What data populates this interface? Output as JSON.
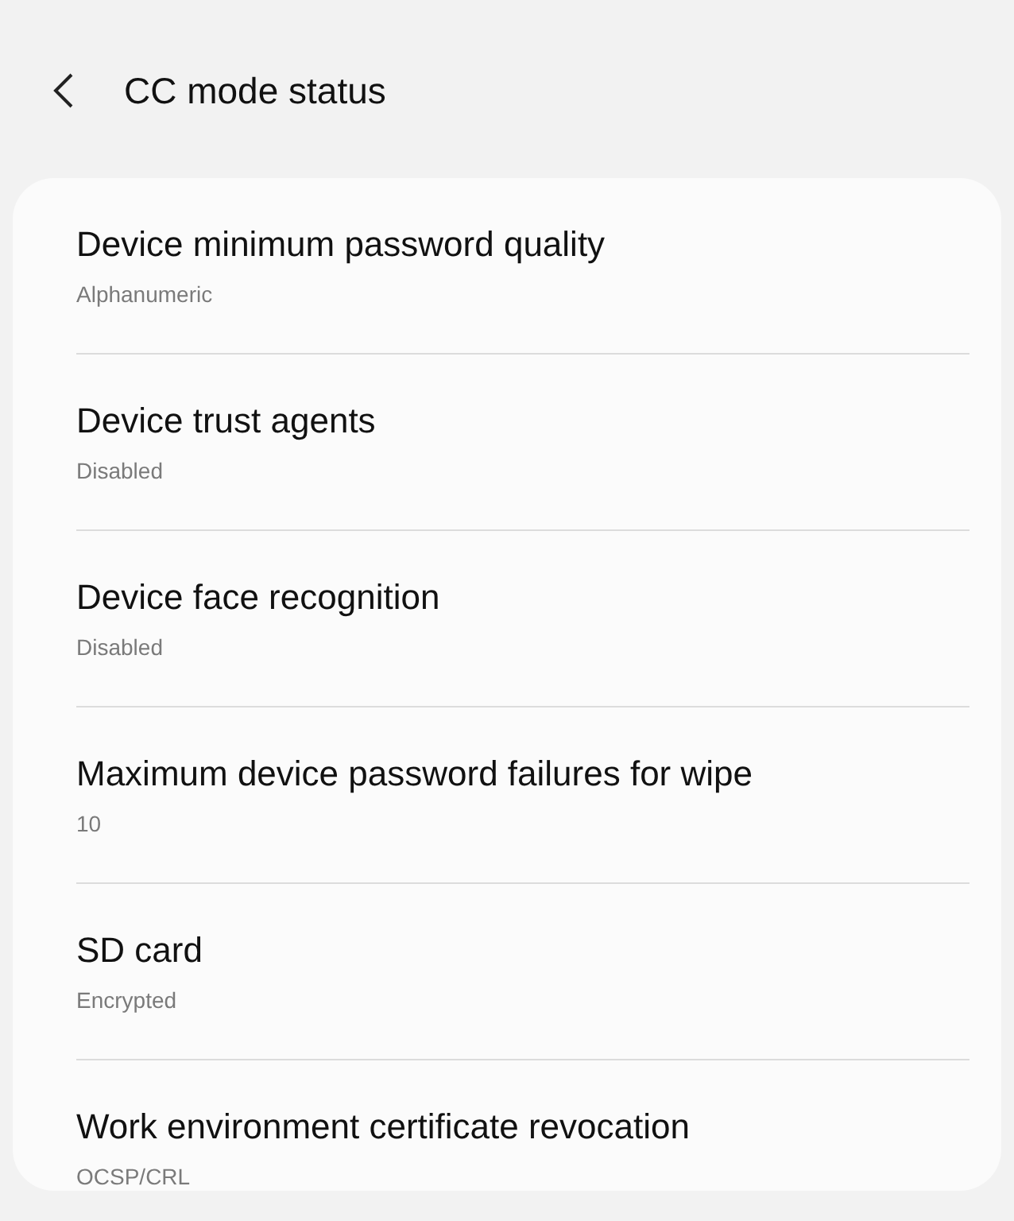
{
  "header": {
    "title": "CC mode status"
  },
  "items": [
    {
      "title": "Device minimum password quality",
      "value": "Alphanumeric"
    },
    {
      "title": "Device trust agents",
      "value": "Disabled"
    },
    {
      "title": "Device face recognition",
      "value": "Disabled"
    },
    {
      "title": "Maximum device password failures for wipe",
      "value": "10"
    },
    {
      "title": "SD card",
      "value": "Encrypted"
    },
    {
      "title": "Work environment certificate revocation",
      "value": "OCSP/CRL"
    }
  ]
}
